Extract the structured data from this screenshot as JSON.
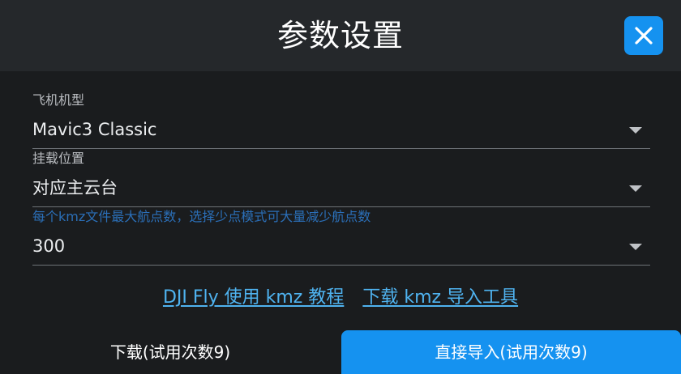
{
  "dialog": {
    "title": "参数设置",
    "close_icon": "close-x-icon",
    "accent_color": "#1592f0"
  },
  "fields": {
    "aircraft_model": {
      "label": "飞机机型",
      "value": "Mavic3 Classic"
    },
    "mount_position": {
      "label": "挂载位置",
      "value": "对应主云台"
    },
    "max_waypoints": {
      "label": "每个kmz文件最大航点数，选择少点模式可大量减少航点数",
      "value": "300"
    }
  },
  "links": {
    "tutorial": "DJI Fly 使用 kmz 教程",
    "download_tool": "下载 kmz 导入工具"
  },
  "footer": {
    "download_label": "下载(试用次数9)",
    "import_label": "直接导入(试用次数9)"
  }
}
